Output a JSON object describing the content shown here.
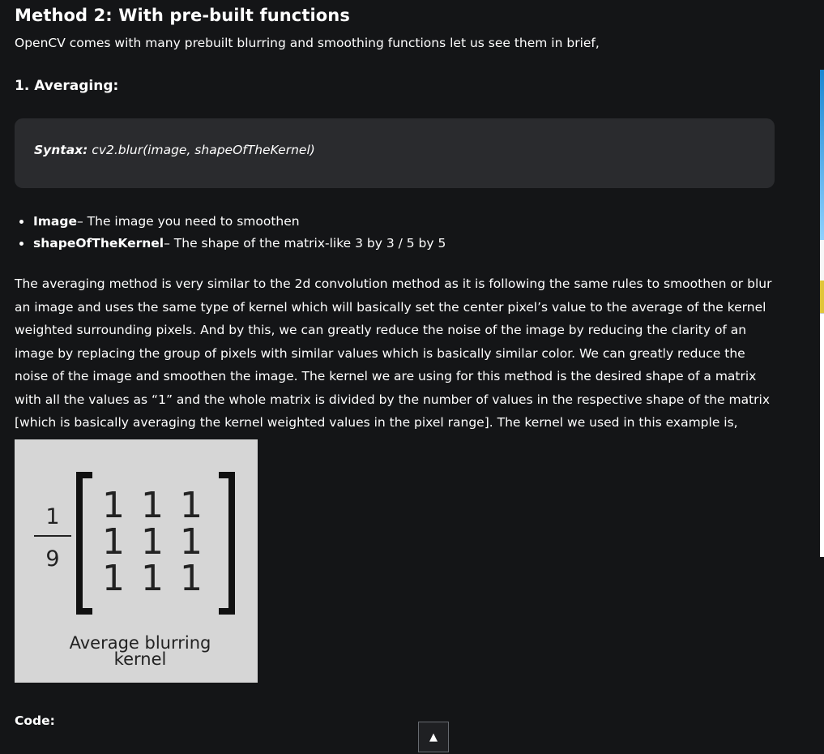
{
  "article": {
    "title": "Method 2:  With pre-built functions",
    "intro": "OpenCV comes with many prebuilt blurring and smoothing functions let us see them in brief,",
    "section_heading": "1. Averaging:",
    "syntax": {
      "label": "Syntax:",
      "code": " cv2.blur(image, shapeOfTheKernel)"
    },
    "parameters": [
      {
        "name": "Image",
        "description": "– The image you need to smoothen"
      },
      {
        "name": "shapeOfTheKernel",
        "description": "– The shape of the matrix-like 3 by 3 / 5 by 5"
      }
    ],
    "paragraph": "The averaging method is very similar to the 2d convolution method as it is following the same rules to smoothen or blur an image and uses the same type of kernel which will basically set the center pixel’s value to the average of the kernel weighted surrounding pixels. And by this, we can greatly reduce the noise of the image by reducing the clarity of an image by replacing the group of pixels with similar values which is basically similar color. We can greatly reduce the noise of the image and smoothen the image. The kernel we are using for this method is the desired shape of a matrix with all the values as “1”  and the whole matrix is divided by the number of values in the respective shape of the matrix [which is basically averaging the kernel weighted values in the pixel range]. The kernel we used in this example is,",
    "figure": {
      "fraction_numerator": "1",
      "fraction_denominator": "9",
      "matrix": [
        [
          "1",
          "1",
          "1"
        ],
        [
          "1",
          "1",
          "1"
        ],
        [
          "1",
          "1",
          "1"
        ]
      ],
      "caption_line1": "Average blurring",
      "caption_line2": "kernel"
    },
    "code_label": "Code:"
  },
  "controls": {
    "scroll_top_icon": "▲"
  },
  "colors": {
    "background": "#141517",
    "syntax_box": "#2a2b2e",
    "figure_background": "#d6d6d6"
  }
}
